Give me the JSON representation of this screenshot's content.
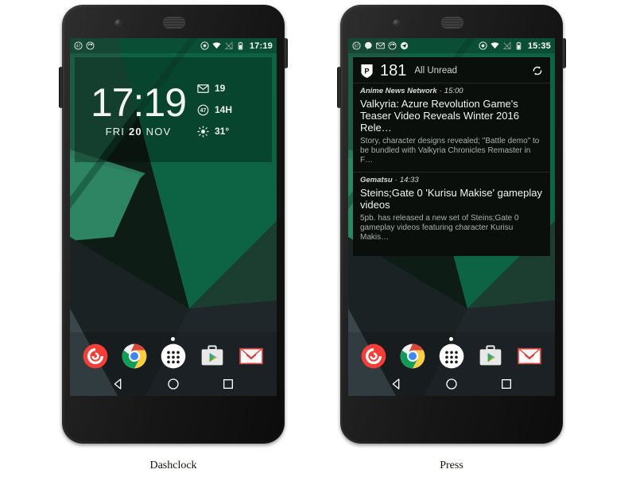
{
  "page": {
    "background_color": "#ffffff",
    "accent_green": "#0e6b44"
  },
  "phones": [
    {
      "caption": "Dashclock",
      "statusbar": {
        "left_icons": [
          "badge-47-icon",
          "sync-icon"
        ],
        "right_icons": [
          "location-icon",
          "wifi-icon",
          "signal-off-icon",
          "battery-icon"
        ],
        "time": "17:19"
      },
      "widget": {
        "type": "dashclock",
        "time": "17:19",
        "date_day": "FRI",
        "date_num": "20",
        "date_month": "NOV",
        "extensions": [
          {
            "icon": "gmail-icon",
            "value": "19"
          },
          {
            "icon": "badge-47-icon",
            "value": "14H"
          },
          {
            "icon": "weather-sun-icon",
            "value": "31°"
          }
        ]
      },
      "dock": {
        "apps": [
          "pocketcasts-icon",
          "chrome-icon",
          "app-drawer-icon",
          "play-store-icon",
          "gmail-icon"
        ]
      },
      "navbar": [
        "back-button",
        "home-button",
        "recents-button"
      ]
    },
    {
      "caption": "Press",
      "statusbar": {
        "left_icons": [
          "badge-57-icon",
          "hangouts-icon",
          "gmail-icon",
          "sync-icon",
          "telegram-icon"
        ],
        "right_icons": [
          "location-icon",
          "wifi-icon",
          "signal-off-icon",
          "battery-icon"
        ],
        "time": "15:35"
      },
      "widget": {
        "type": "press",
        "app_icon": "press-shield-icon",
        "unread_count": "181",
        "feed_title": "All Unread",
        "refresh_icon": "refresh-icon",
        "articles": [
          {
            "source": "Anime News Network",
            "separator": "·",
            "time": "15:00",
            "headline": "Valkyria: Azure Revolution Game's Teaser Video Reveals Winter 2016 Rele…",
            "snippet": "Story, character designs revealed; \"Battle demo\" to be bundled with Valkyria Chronicles Remaster in F…"
          },
          {
            "source": "Gematsu",
            "separator": "·",
            "time": "14:33",
            "headline": "Steins;Gate 0 'Kurisu Makise' gameplay videos",
            "snippet": "5pb. has released a new set of Steins;Gate 0 gameplay videos featuring character Kurisu Makis…"
          }
        ]
      },
      "dock": {
        "apps": [
          "pocketcasts-icon",
          "chrome-icon",
          "app-drawer-icon",
          "play-store-icon",
          "gmail-icon"
        ]
      },
      "navbar": [
        "back-button",
        "home-button",
        "recents-button"
      ]
    }
  ]
}
